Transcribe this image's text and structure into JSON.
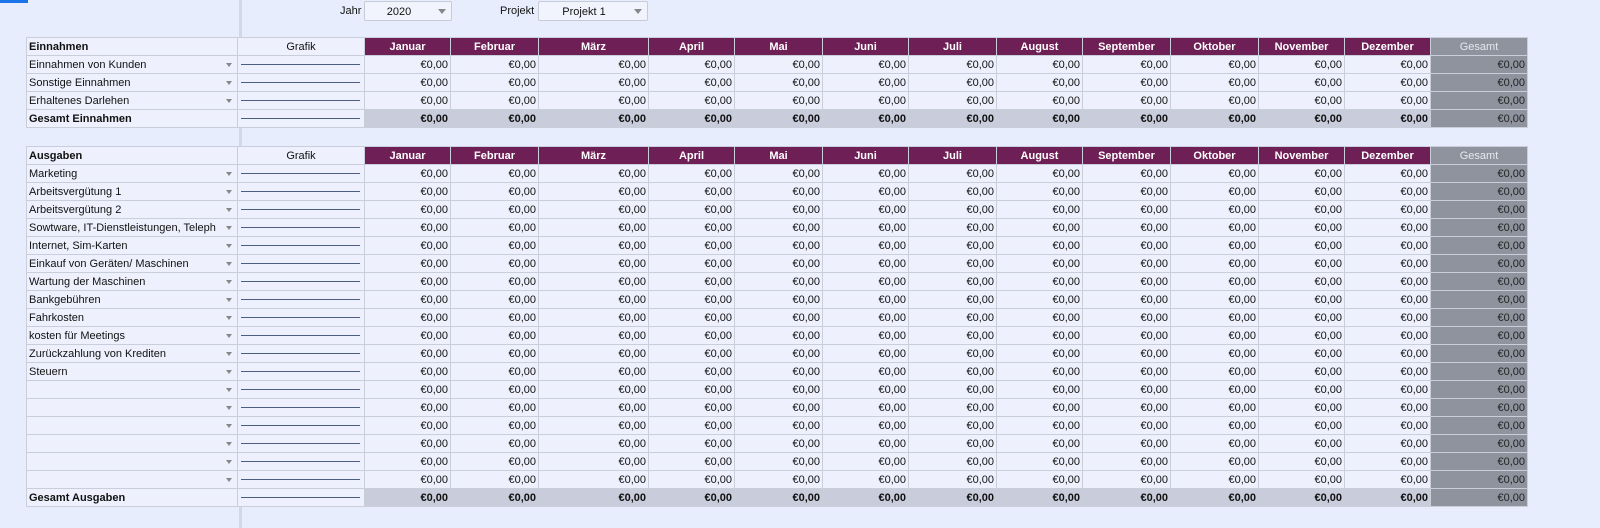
{
  "filters": {
    "year_label": "Jahr",
    "year_value": "2020",
    "project_label": "Projekt",
    "project_value": "Projekt 1"
  },
  "grafik_label": "Grafik",
  "months": [
    "Januar",
    "Februar",
    "März",
    "April",
    "Mai",
    "Juni",
    "Juli",
    "August",
    "September",
    "Oktober",
    "November",
    "Dezember"
  ],
  "total_label": "Gesamt",
  "zero_value": "€0,00",
  "einnahmen": {
    "title": "Einnahmen",
    "rows": [
      "Einnahmen von Kunden",
      "Sonstige Einnahmen",
      "Erhaltenes Darlehen"
    ],
    "sum_label": "Gesamt Einnahmen"
  },
  "ausgaben": {
    "title": "Ausgaben",
    "rows": [
      "Marketing",
      "Arbeitsvergütung 1",
      "Arbeitsvergütung 2",
      "Sowtware, IT-Dienstleistungen, Teleph",
      "Internet, Sim-Karten",
      "Einkauf von Geräten/ Maschinen",
      "Wartung der Maschinen",
      "Bankgebühren",
      "Fahrkosten",
      "kosten für Meetings",
      "Zurückzahlung von Krediten",
      "Steuern",
      "",
      "",
      "",
      "",
      "",
      ""
    ],
    "sum_label": "Gesamt Ausgaben"
  },
  "colors": {
    "month_header": "#6e1f55",
    "total_column": "#8e939e",
    "sheet_background": "#e8edfd",
    "sum_row": "#c8ccdb"
  }
}
